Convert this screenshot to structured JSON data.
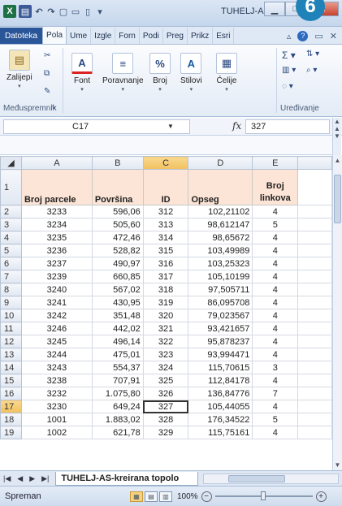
{
  "window": {
    "title": "TUHELJ-A...",
    "step_badge": "6"
  },
  "ribbon_tabs": [
    "Datoteka",
    "Pola",
    "Ume",
    "Izgle",
    "Forn",
    "Podi",
    "Preg",
    "Prikz",
    "Esri"
  ],
  "ribbon": {
    "paste_label": "Zalijepi",
    "font_label": "Font",
    "align_label": "Poravnanje",
    "number_label": "Broj",
    "styles_label": "Stilovi",
    "cells_label": "Ćelije",
    "clipboard_group": "Međuspremnik",
    "editing_group": "Uređivanje"
  },
  "formula_bar": {
    "name_box": "C17",
    "fx": "fx",
    "value": "327"
  },
  "columns": [
    "A",
    "B",
    "C",
    "D",
    "E"
  ],
  "header_row": {
    "row": "1",
    "cells": [
      "Broj parcele",
      "Površina",
      "ID",
      "Opseg",
      "Broj linkova"
    ]
  },
  "rows": [
    {
      "n": "2",
      "a": "3233",
      "b": "596,06",
      "c": "312",
      "d": "102,21102",
      "e": "4"
    },
    {
      "n": "3",
      "a": "3234",
      "b": "505,60",
      "c": "313",
      "d": "98,612147",
      "e": "5"
    },
    {
      "n": "4",
      "a": "3235",
      "b": "472,46",
      "c": "314",
      "d": "98,65672",
      "e": "4"
    },
    {
      "n": "5",
      "a": "3236",
      "b": "528,82",
      "c": "315",
      "d": "103,49989",
      "e": "4"
    },
    {
      "n": "6",
      "a": "3237",
      "b": "490,97",
      "c": "316",
      "d": "103,25323",
      "e": "4"
    },
    {
      "n": "7",
      "a": "3239",
      "b": "660,85",
      "c": "317",
      "d": "105,10199",
      "e": "4"
    },
    {
      "n": "8",
      "a": "3240",
      "b": "567,02",
      "c": "318",
      "d": "97,505711",
      "e": "4"
    },
    {
      "n": "9",
      "a": "3241",
      "b": "430,95",
      "c": "319",
      "d": "86,095708",
      "e": "4"
    },
    {
      "n": "10",
      "a": "3242",
      "b": "351,48",
      "c": "320",
      "d": "79,023567",
      "e": "4"
    },
    {
      "n": "11",
      "a": "3246",
      "b": "442,02",
      "c": "321",
      "d": "93,421657",
      "e": "4"
    },
    {
      "n": "12",
      "a": "3245",
      "b": "496,14",
      "c": "322",
      "d": "95,878237",
      "e": "4"
    },
    {
      "n": "13",
      "a": "3244",
      "b": "475,01",
      "c": "323",
      "d": "93,994471",
      "e": "4"
    },
    {
      "n": "14",
      "a": "3243",
      "b": "554,37",
      "c": "324",
      "d": "115,70615",
      "e": "3"
    },
    {
      "n": "15",
      "a": "3238",
      "b": "707,91",
      "c": "325",
      "d": "112,84178",
      "e": "4"
    },
    {
      "n": "16",
      "a": "3232",
      "b": "1.075,80",
      "c": "326",
      "d": "136,84776",
      "e": "7"
    },
    {
      "n": "17",
      "a": "3230",
      "b": "649,24",
      "c": "327",
      "d": "105,44055",
      "e": "4"
    },
    {
      "n": "18",
      "a": "1001",
      "b": "1.883,02",
      "c": "328",
      "d": "176,34522",
      "e": "5"
    },
    {
      "n": "19",
      "a": "1002",
      "b": "621,78",
      "c": "329",
      "d": "115,75161",
      "e": "4"
    }
  ],
  "sheet_tab": "TUHELJ-AS-kreirana topolo",
  "status": {
    "text": "Spreman",
    "zoom": "100%"
  }
}
